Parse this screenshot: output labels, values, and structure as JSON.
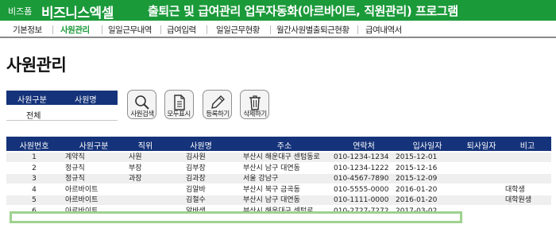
{
  "header": {
    "brand_small": "비즈폼",
    "brand_big": "비즈니스엑셀",
    "title": "출퇴근 및 급여관리 업무자동화(아르바이트, 직원관리) 프로그램",
    "bg_color": "#1b9a3a"
  },
  "menu": {
    "items": [
      {
        "label": "기본정보",
        "active": false
      },
      {
        "label": "사원관리",
        "active": true
      },
      {
        "label": "일일근무내역",
        "active": false
      },
      {
        "label": "급여입력",
        "active": false
      },
      {
        "label": "일일근무현황",
        "active": false
      },
      {
        "label": "월간사원별출퇴근현황",
        "active": false
      },
      {
        "label": "급여내역서",
        "active": false
      }
    ]
  },
  "page": {
    "title": "사원관리"
  },
  "filter": {
    "headers": [
      "사원구분",
      "사원명"
    ],
    "value": "전체"
  },
  "toolbar": {
    "buttons": [
      {
        "label": "사원검색",
        "icon": "search-icon"
      },
      {
        "label": "모두표시",
        "icon": "document-icon"
      },
      {
        "label": "등록하기",
        "icon": "pencil-icon"
      },
      {
        "label": "삭제하기",
        "icon": "trash-icon"
      }
    ]
  },
  "table": {
    "columns": [
      "사원번호",
      "사원구분",
      "직위",
      "사원명",
      "주소",
      "연락처",
      "입사일자",
      "퇴사일자",
      "비고"
    ],
    "rows": [
      [
        "1",
        "계약직",
        "사원",
        "김사원",
        "부산시 해운대구 센텀동로",
        "010-1234-1234",
        "2015-12-01",
        "",
        ""
      ],
      [
        "2",
        "정규직",
        "부장",
        "김부장",
        "부산시 남구 대연동",
        "010-1234-1222",
        "2015-12-16",
        "",
        ""
      ],
      [
        "3",
        "정규직",
        "과장",
        "김과장",
        "서울 강남구",
        "010-4567-7890",
        "2015-12-09",
        "",
        ""
      ],
      [
        "4",
        "아르바이트",
        "",
        "김알바",
        "부산시 북구 금곡동",
        "010-5555-0000",
        "2016-01-20",
        "",
        "대학생"
      ],
      [
        "5",
        "아르바이트",
        "",
        "김철수",
        "부산시 남구 대연동",
        "010-1111-0000",
        "2016-01-20",
        "",
        "대학원생"
      ],
      [
        "6",
        "아르바이트",
        "",
        "알바생",
        "부산시 해운대구 센텀로",
        "010-2727-7272",
        "2017-03-02",
        "",
        ""
      ]
    ],
    "header_color": "#15337a",
    "highlight_color": "#9fd290"
  }
}
